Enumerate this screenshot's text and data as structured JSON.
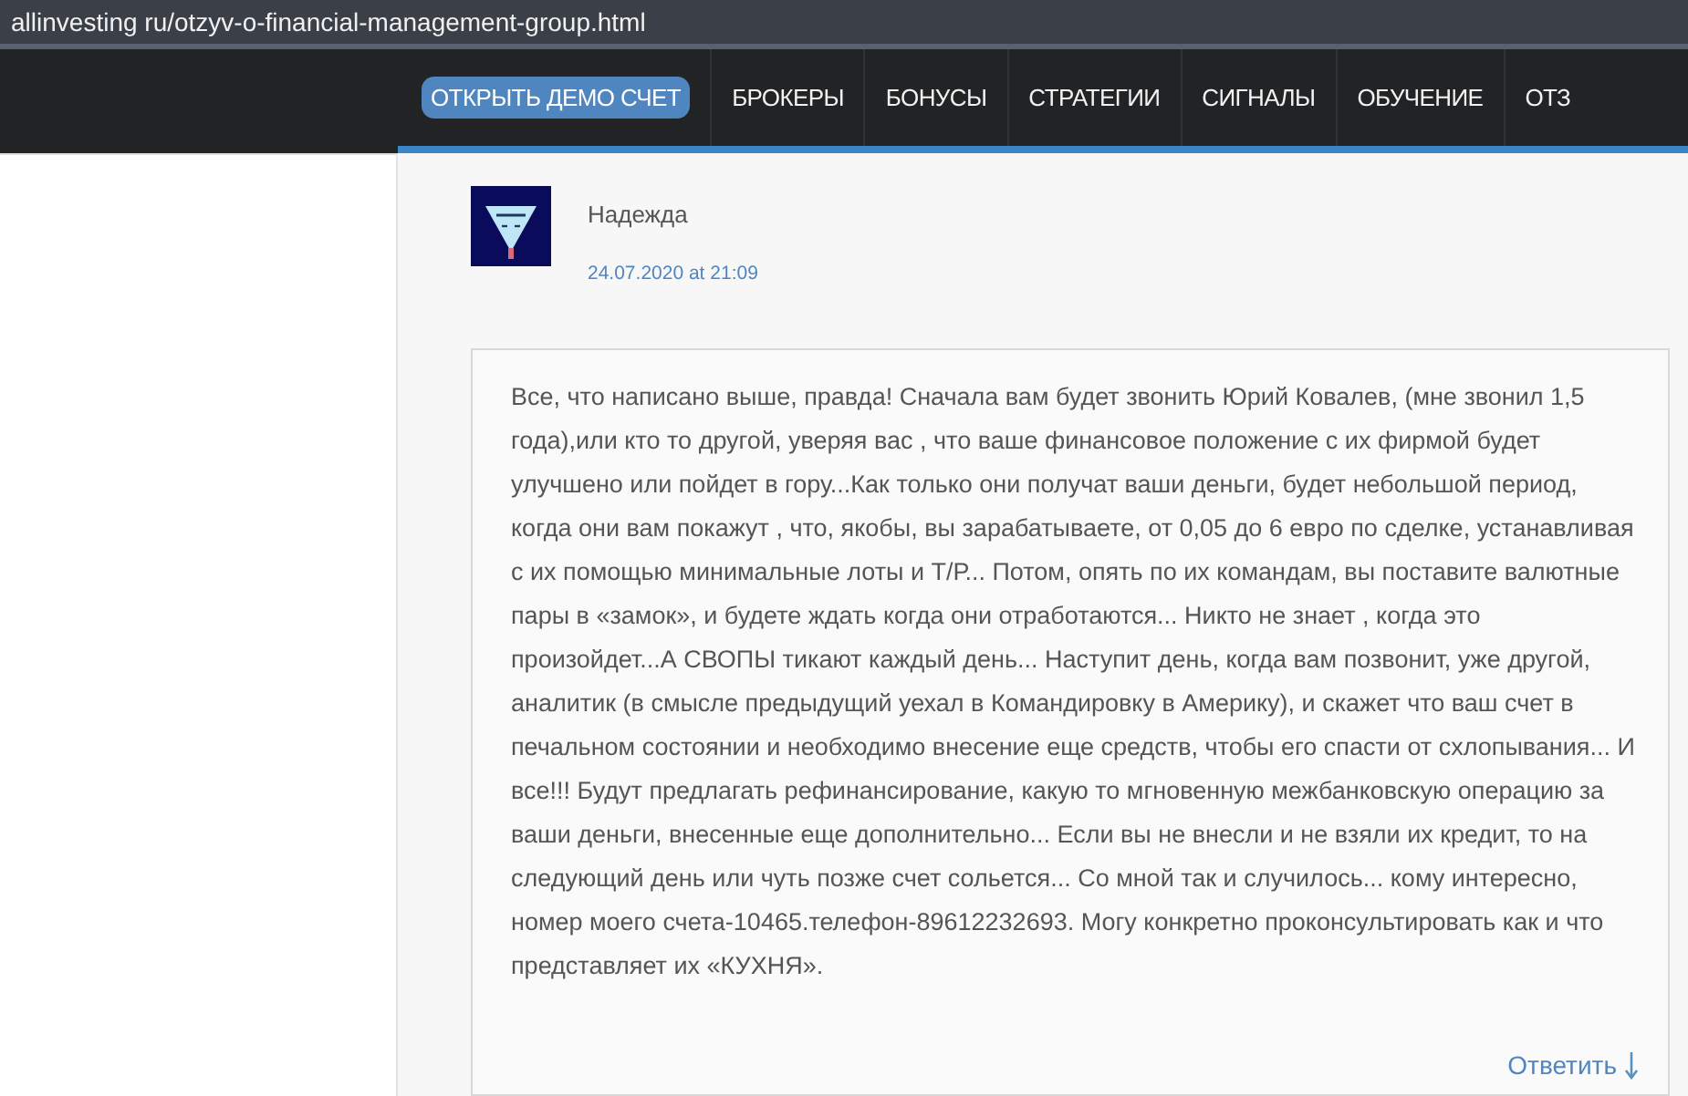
{
  "address_bar": {
    "url": "allinvesting ru/otzyv-o-financial-management-group.html"
  },
  "nav": {
    "items": [
      {
        "label": "ОТКРЫТЬ ДЕМО СЧЕТ",
        "kind": "cta"
      },
      {
        "label": "БРОКЕРЫ",
        "kind": "link"
      },
      {
        "label": "БОНУСЫ",
        "kind": "link"
      },
      {
        "label": "СТРАТЕГИИ",
        "kind": "link"
      },
      {
        "label": "СИГНАЛЫ",
        "kind": "link"
      },
      {
        "label": "ОБУЧЕНИЕ",
        "kind": "link"
      },
      {
        "label": "ОТЗ",
        "kind": "link"
      }
    ]
  },
  "comment": {
    "author": "Надежда",
    "date": "24.07.2020 at 21:09",
    "text": "Все, что написано выше, правда! Сначала вам будет звонить Юрий Ковалев, (мне звонил 1,5 года),или кто то другой, уверяя вас , что ваше финансовое положение с их фирмой будет улучшено или пойдет в гору...Как только они получат ваши деньги, будет небольшой период, когда они вам покажут , что, якобы, вы зарабатываете, от 0,05 до 6 евро по сделке, устанавливая с их помощью минимальные лоты и Т/Р... Потом, опять по их командам, вы поставите валютные пары в «замок», и будете ждать когда они отработаются... Никто не знает , когда это произойдет...А СВОПЫ тикают каждый день... Наступит день, когда вам позвонит, уже другой, аналитик (в смысле предыдущий уехал в Командировку в Америку), и скажет что ваш счет в печальном состоянии и необходимо внесение еще средств, чтобы его спасти от схлопывания... И все!!! Будут предлагать рефинансирование, какую то мгновенную межбанковскую операцию за ваши деньги, внесенные еще дополнительно... Если вы не внесли и не взяли их кредит, то на следующий день или чуть позже счет сольется... Со мной так и случилось... кому интересно, номер моего счета-10465.телефон-89612232693. Могу конкретно проконсультировать как и что представляет их «КУХНЯ».",
    "reply": "Ответить"
  }
}
